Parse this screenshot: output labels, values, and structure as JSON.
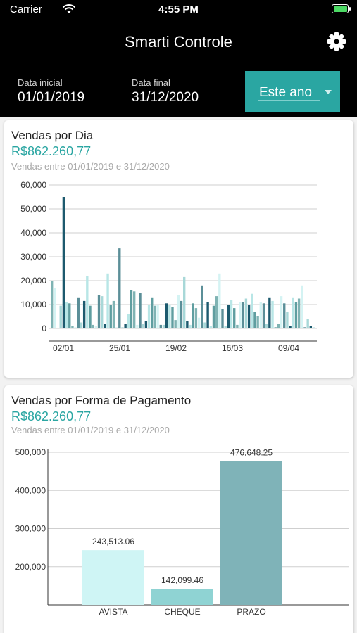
{
  "status": {
    "carrier": "Carrier",
    "time": "4:55 PM"
  },
  "header": {
    "title": "Smarti Controle"
  },
  "dates": {
    "start_label": "Data inicial",
    "start_value": "01/01/2019",
    "end_label": "Data final",
    "end_value": "31/12/2020",
    "period": "Este ano"
  },
  "daily_card": {
    "title": "Vendas por Dia",
    "amount": "R$862.260,77",
    "subtitle": "Vendas entre 01/01/2019 e 31/12/2020"
  },
  "payment_card": {
    "title": "Vendas por Forma de Pagamento",
    "amount": "R$862.260,77",
    "subtitle": "Vendas entre 01/01/2019 e 31/12/2020"
  },
  "colors": {
    "accent": "#2aa6a2",
    "daily_palette": [
      "#7fb3b3",
      "#d4f3f3",
      "#5b8f98",
      "#a8d8d8",
      "#1d5a6e",
      "#b8e6e6",
      "#5f9ea0"
    ],
    "avista": "#cff5f5",
    "cheque": "#8fd3d3",
    "prazo": "#7fb3b8"
  },
  "chart_data": [
    {
      "type": "bar",
      "title": "",
      "x_tick_labels": [
        "02/01",
        "25/01",
        "19/02",
        "16/03",
        "09/04"
      ],
      "y_tick_labels": [
        "0",
        "10,000",
        "20,000",
        "30,000",
        "40,000",
        "50,000",
        "60,000"
      ],
      "ylim": [
        0,
        60000
      ],
      "grid": true,
      "values": [
        20000,
        17000,
        0,
        9500,
        55000,
        11000,
        10500,
        1000,
        500,
        13000,
        2500,
        11500,
        22000,
        9500,
        1500,
        1000,
        14000,
        13500,
        2000,
        23000,
        10000,
        11500,
        500,
        33500,
        500,
        2000,
        6000,
        16000,
        15500,
        1500,
        15000,
        2000,
        3000,
        10000,
        13000,
        9500,
        10000,
        1500,
        1500,
        10500,
        10000,
        9000,
        3500,
        14000,
        11500,
        21500,
        3000,
        1500,
        10500,
        8500,
        4500,
        18000,
        2500,
        11000,
        1000,
        9500,
        13500,
        23000,
        8000,
        1000,
        10000,
        12000,
        8500,
        1500,
        11000,
        11000,
        12500,
        10000,
        14500,
        7000,
        5000,
        11000,
        10500,
        2000,
        13000,
        11500,
        500,
        2000,
        13500,
        10500,
        7000,
        1000,
        13000,
        11000,
        12500,
        18000,
        500,
        4000,
        1000,
        500
      ]
    },
    {
      "type": "bar",
      "title": "",
      "categories": [
        "AVISTA",
        "CHEQUE",
        "PRAZO"
      ],
      "values": [
        243513.06,
        142099.46,
        476648.25
      ],
      "value_labels": [
        "243,513.06",
        "142,099.46",
        "476,648.25"
      ],
      "y_tick_labels": [
        "200,000",
        "300,000",
        "400,000",
        "500,000"
      ],
      "ylim": [
        100000,
        500000
      ],
      "grid": true
    }
  ]
}
